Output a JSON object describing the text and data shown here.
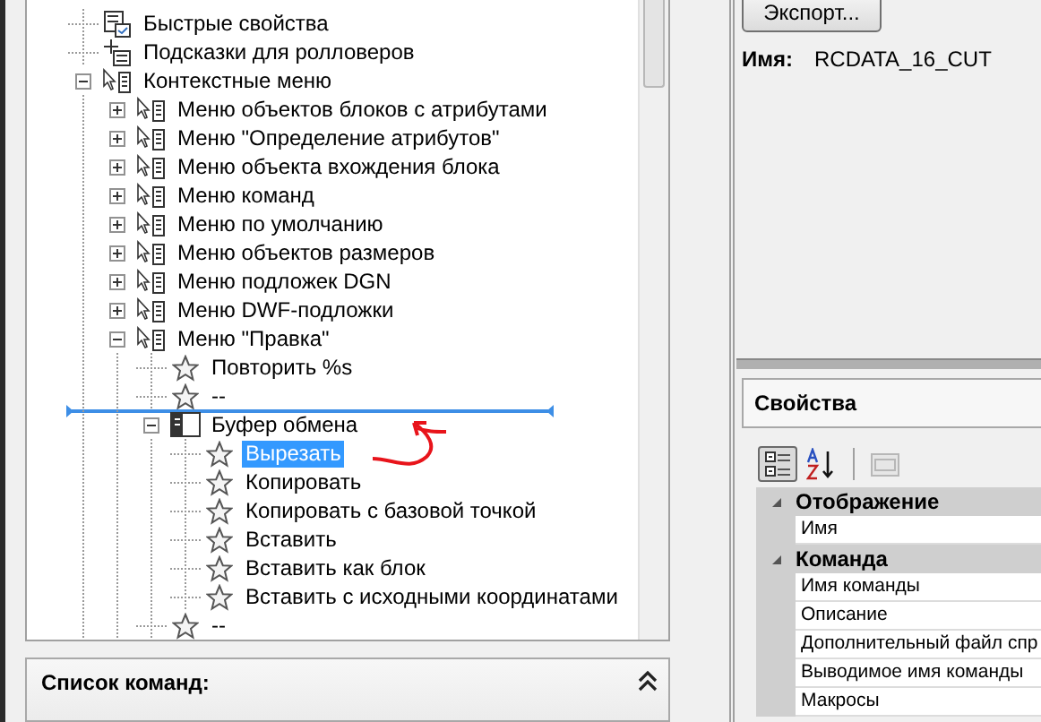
{
  "tree": [
    {
      "label": "Быстрые свойства",
      "kind": "properties",
      "selected": false
    },
    {
      "label": "Подсказки для ролловеров",
      "kind": "rollover",
      "selected": false
    },
    {
      "label": "Контекстные меню",
      "kind": "menu",
      "selected": false,
      "expanded": true,
      "children": [
        {
          "label": "Меню объектов блоков с атрибутами",
          "kind": "menu",
          "selected": false,
          "expanded": false
        },
        {
          "label": "Меню \"Определение атрибутов\"",
          "kind": "menu",
          "selected": false,
          "expanded": false
        },
        {
          "label": "Меню объекта вхождения блока",
          "kind": "menu",
          "selected": false,
          "expanded": false
        },
        {
          "label": "Меню команд",
          "kind": "menu",
          "selected": false,
          "expanded": false
        },
        {
          "label": "Меню по умолчанию",
          "kind": "menu",
          "selected": false,
          "expanded": false
        },
        {
          "label": "Меню объектов размеров",
          "kind": "menu",
          "selected": false,
          "expanded": false
        },
        {
          "label": "Меню подложек DGN",
          "kind": "menu",
          "selected": false,
          "expanded": false
        },
        {
          "label": "Меню DWF-подложки",
          "kind": "menu",
          "selected": false,
          "expanded": false
        },
        {
          "label": "Меню \"Правка\"",
          "kind": "menu",
          "selected": false,
          "expanded": true,
          "children": [
            {
              "label": "Повторить %s",
              "kind": "star",
              "selected": false
            },
            {
              "label": "--",
              "kind": "star",
              "selected": false,
              "drop_target": true
            },
            {
              "label": "Буфер обмена",
              "kind": "panel",
              "selected": false,
              "expanded": true,
              "children": [
                {
                  "label": "Вырезать",
                  "kind": "star",
                  "selected": true
                },
                {
                  "label": "Копировать",
                  "kind": "star",
                  "selected": false
                },
                {
                  "label": "Копировать с базовой точкой",
                  "kind": "star",
                  "selected": false
                },
                {
                  "label": "Вставить",
                  "kind": "star",
                  "selected": false
                },
                {
                  "label": "Вставить как блок",
                  "kind": "star",
                  "selected": false
                },
                {
                  "label": "Вставить с исходными координатами",
                  "kind": "star",
                  "selected": false
                }
              ]
            },
            {
              "label": "--",
              "kind": "star",
              "selected": false
            }
          ]
        }
      ]
    }
  ],
  "command_list": {
    "title": "Список команд:"
  },
  "preview": {
    "export_button": "Экспорт...",
    "name_label": "Имя:",
    "name_value": "RCDATA_16_CUT"
  },
  "properties": {
    "title": "Свойства",
    "toolbar": [
      {
        "kind": "categorized",
        "selected": true,
        "disabled": false
      },
      {
        "kind": "alphabetical",
        "selected": false,
        "disabled": false
      },
      {
        "kind": "pages",
        "selected": false,
        "disabled": true
      }
    ],
    "categories": [
      {
        "name": "Отображение",
        "expanded": true,
        "rows": [
          "Имя"
        ]
      },
      {
        "name": "Команда",
        "expanded": true,
        "rows": [
          "Имя команды",
          "Описание",
          "Дополнительный файл спр",
          "Выводимое имя команды",
          "Макросы"
        ]
      }
    ]
  }
}
